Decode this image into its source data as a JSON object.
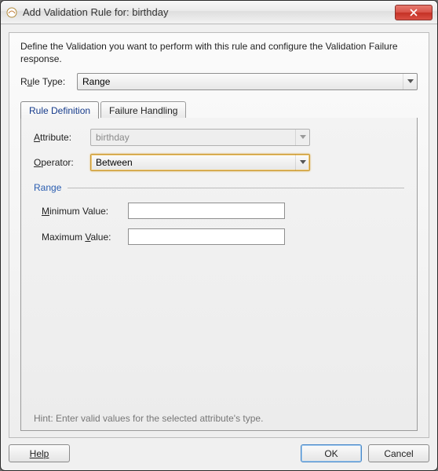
{
  "title": "Add Validation Rule for: birthday",
  "instruction": "Define the Validation you want to perform with this rule and configure the Validation Failure response.",
  "ruleTypeLabelPre": "R",
  "ruleTypeLabelU": "u",
  "ruleTypeLabelPost": "le Type:",
  "ruleTypeValue": "Range",
  "tabs": {
    "definition": "Rule Definition",
    "failure": "Failure Handling"
  },
  "form": {
    "attributeLabelU": "A",
    "attributeLabelPost": "ttribute:",
    "attributeValue": "birthday",
    "operatorLabelU": "O",
    "operatorLabelPost": "perator:",
    "operatorValue": "Between",
    "rangeLegend": "Range",
    "minLabelU": "M",
    "minLabelPost": "inimum Value:",
    "maxLabelPre": "Maximum ",
    "maxLabelU": "V",
    "maxLabelPost": "alue:",
    "minValue": "",
    "maxValue": ""
  },
  "hint": "Hint: Enter valid values for the selected attribute's type.",
  "buttons": {
    "help": "Help",
    "ok": "OK",
    "cancel": "Cancel"
  }
}
